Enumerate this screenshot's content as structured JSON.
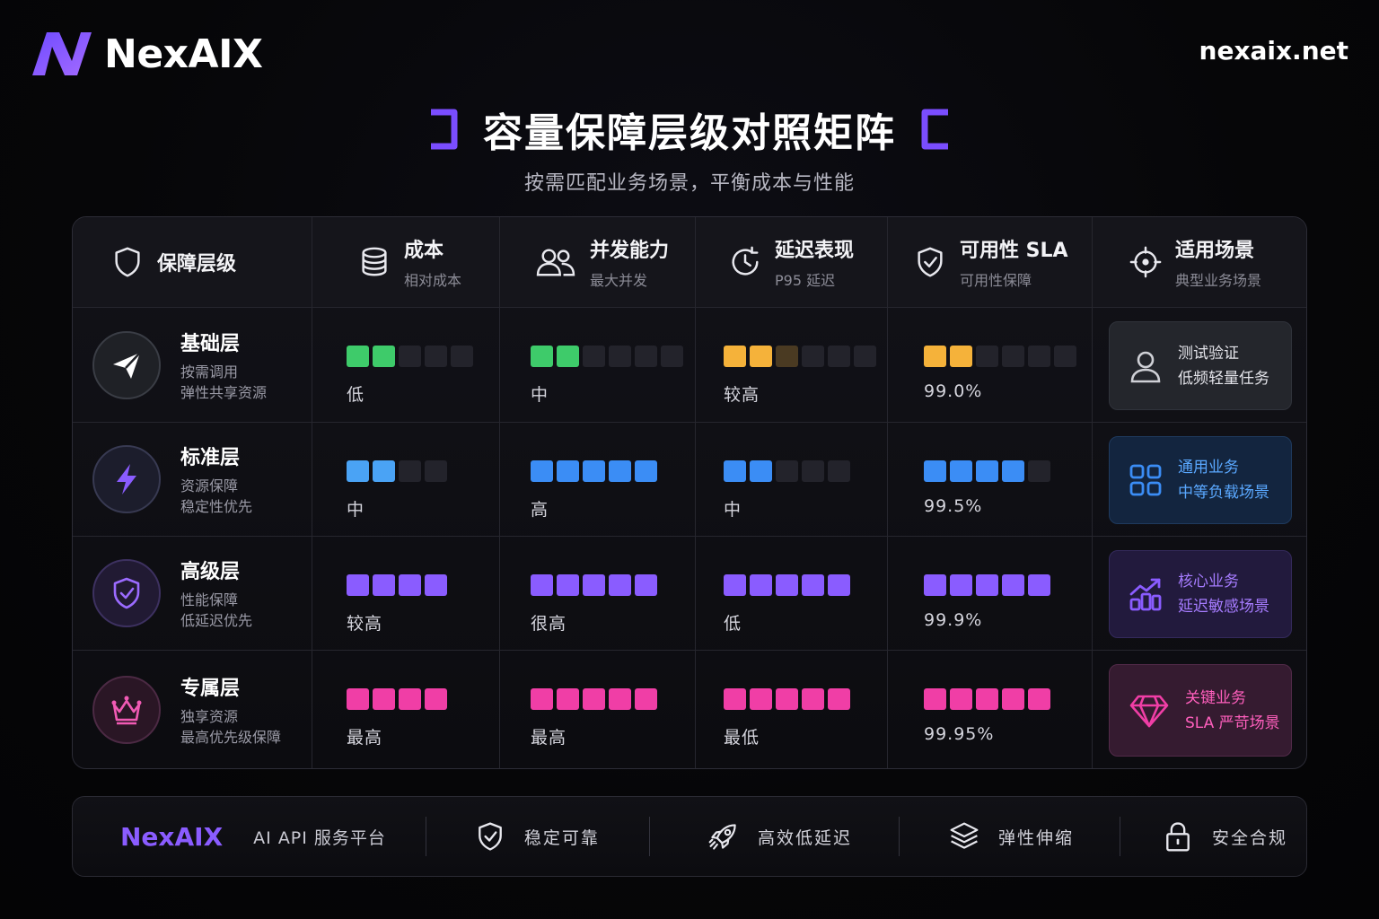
{
  "brand": {
    "name": "NexAIX",
    "url": "nexaix.net"
  },
  "title": "容量保障层级对照矩阵",
  "subtitle": "按需匹配业务场景，平衡成本与性能",
  "colors": {
    "accent": "#8a5cff",
    "green": "#3ecb6a",
    "orange": "#f5b23a",
    "blue": "#3b8df5",
    "purple": "#8a5cff",
    "pink": "#f03ea6"
  },
  "headers": [
    {
      "title": "保障层级",
      "sub": "",
      "icon": "shield-icon"
    },
    {
      "title": "成本",
      "sub": "相对成本",
      "icon": "coins-stack-icon"
    },
    {
      "title": "并发能力",
      "sub": "最大并发",
      "icon": "users-icon"
    },
    {
      "title": "延迟表现",
      "sub": "P95 延迟",
      "icon": "clock-icon"
    },
    {
      "title": "可用性 SLA",
      "sub": "可用性保障",
      "icon": "shield-check-icon"
    },
    {
      "title": "适用场景",
      "sub": "典型业务场景",
      "icon": "crosshair-icon"
    }
  ],
  "tiers": [
    {
      "name": "基础层",
      "desc1": "按需调用",
      "desc2": "弹性共享资源",
      "icon": "paper-plane-icon",
      "cost": {
        "label": "低",
        "level": 2,
        "total": 5,
        "color": "#3ecb6a"
      },
      "concurrency": {
        "label": "中",
        "level": 2,
        "total": 6,
        "color": "#3ecb6a"
      },
      "latency": {
        "label": "较高",
        "level": 2,
        "total": 6,
        "color": "#f5b23a",
        "dim": 1
      },
      "sla": {
        "label": "99.0%",
        "level": 2,
        "total": 6,
        "color": "#f5b23a"
      },
      "scenario": {
        "line1": "测试验证",
        "line2": "低频轻量任务",
        "icon": "user-icon"
      }
    },
    {
      "name": "标准层",
      "desc1": "资源保障",
      "desc2": "稳定性优先",
      "icon": "lightning-icon",
      "cost": {
        "label": "中",
        "level": 2,
        "total": 4,
        "color": "#4aa3f5"
      },
      "concurrency": {
        "label": "高",
        "level": 5,
        "total": 5,
        "color": "#3b8df5"
      },
      "latency": {
        "label": "中",
        "level": 2,
        "total": 5,
        "color": "#3b8df5"
      },
      "sla": {
        "label": "99.5%",
        "level": 4,
        "total": 5,
        "color": "#3b8df5"
      },
      "scenario": {
        "line1": "通用业务",
        "line2": "中等负载场景",
        "icon": "grid-icon"
      }
    },
    {
      "name": "高级层",
      "desc1": "性能保障",
      "desc2": "低延迟优先",
      "icon": "shield-check-icon",
      "cost": {
        "label": "较高",
        "level": 4,
        "total": 4,
        "color": "#8a5cff"
      },
      "concurrency": {
        "label": "很高",
        "level": 5,
        "total": 5,
        "color": "#8a5cff"
      },
      "latency": {
        "label": "低",
        "level": 5,
        "total": 5,
        "color": "#8a5cff"
      },
      "sla": {
        "label": "99.9%",
        "level": 5,
        "total": 5,
        "color": "#8a5cff"
      },
      "scenario": {
        "line1": "核心业务",
        "line2": "延迟敏感场景",
        "icon": "chart-growth-icon"
      }
    },
    {
      "name": "专属层",
      "desc1": "独享资源",
      "desc2": "最高优先级保障",
      "icon": "crown-icon",
      "cost": {
        "label": "最高",
        "level": 4,
        "total": 4,
        "color": "#f03ea6"
      },
      "concurrency": {
        "label": "最高",
        "level": 5,
        "total": 5,
        "color": "#f03ea6"
      },
      "latency": {
        "label": "最低",
        "level": 5,
        "total": 5,
        "color": "#f03ea6"
      },
      "sla": {
        "label": "99.95%",
        "level": 5,
        "total": 5,
        "color": "#f03ea6"
      },
      "scenario": {
        "line1": "关键业务",
        "line2": "SLA 严苛场景",
        "icon": "diamond-icon"
      }
    }
  ],
  "footer": {
    "brand": "NexAIX",
    "tagline": "AI API 服务平台",
    "features": [
      {
        "label": "稳定可靠",
        "icon": "shield-check-icon"
      },
      {
        "label": "高效低延迟",
        "icon": "rocket-icon"
      },
      {
        "label": "弹性伸缩",
        "icon": "layers-icon"
      },
      {
        "label": "安全合规",
        "icon": "lock-icon"
      }
    ]
  }
}
